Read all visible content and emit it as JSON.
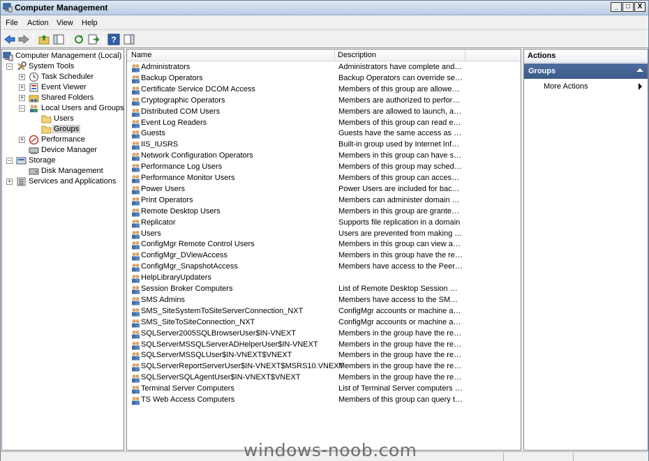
{
  "window": {
    "title": "Computer Management"
  },
  "window_buttons": [
    "_",
    "□",
    "X"
  ],
  "menu": [
    "File",
    "Action",
    "View",
    "Help"
  ],
  "tree": [
    {
      "label": "Computer Management (Local)",
      "level": 0,
      "expander": "",
      "icon": "computer-management-icon"
    },
    {
      "label": "System Tools",
      "level": 1,
      "expander": "−",
      "icon": "system-tools-icon"
    },
    {
      "label": "Task Scheduler",
      "level": 2,
      "expander": "+",
      "icon": "clock-icon"
    },
    {
      "label": "Event Viewer",
      "level": 2,
      "expander": "+",
      "icon": "event-viewer-icon"
    },
    {
      "label": "Shared Folders",
      "level": 2,
      "expander": "+",
      "icon": "shared-folder-icon"
    },
    {
      "label": "Local Users and Groups",
      "level": 2,
      "expander": "−",
      "icon": "users-icon"
    },
    {
      "label": "Users",
      "level": 3,
      "expander": "",
      "icon": "folder-icon"
    },
    {
      "label": "Groups",
      "level": 3,
      "expander": "",
      "icon": "folder-icon",
      "selected": true
    },
    {
      "label": "Performance",
      "level": 2,
      "expander": "+",
      "icon": "performance-icon"
    },
    {
      "label": "Device Manager",
      "level": 2,
      "expander": "",
      "icon": "device-manager-icon"
    },
    {
      "label": "Storage",
      "level": 1,
      "expander": "−",
      "icon": "storage-icon"
    },
    {
      "label": "Disk Management",
      "level": 2,
      "expander": "",
      "icon": "disk-icon"
    },
    {
      "label": "Services and Applications",
      "level": 1,
      "expander": "+",
      "icon": "services-icon"
    }
  ],
  "list": {
    "columns": [
      "Name",
      "Description"
    ],
    "rows": [
      {
        "name": "Administrators",
        "description": "Administrators have complete and u..."
      },
      {
        "name": "Backup Operators",
        "description": "Backup Operators can override secu..."
      },
      {
        "name": "Certificate Service DCOM Access",
        "description": "Members of this group are allowed t..."
      },
      {
        "name": "Cryptographic Operators",
        "description": "Members are authorized to perform ..."
      },
      {
        "name": "Distributed COM Users",
        "description": "Members are allowed to launch, acti..."
      },
      {
        "name": "Event Log Readers",
        "description": "Members of this group can read eve..."
      },
      {
        "name": "Guests",
        "description": "Guests have the same access as me..."
      },
      {
        "name": "IIS_IUSRS",
        "description": "Built-in group used by Internet Infor..."
      },
      {
        "name": "Network Configuration Operators",
        "description": "Members in this group can have som..."
      },
      {
        "name": "Performance Log Users",
        "description": "Members of this group may schedule..."
      },
      {
        "name": "Performance Monitor Users",
        "description": "Members of this group can access p..."
      },
      {
        "name": "Power Users",
        "description": "Power Users are included for backw..."
      },
      {
        "name": "Print Operators",
        "description": "Members can administer domain prin..."
      },
      {
        "name": "Remote Desktop Users",
        "description": "Members in this group are granted t..."
      },
      {
        "name": "Replicator",
        "description": "Supports file replication in a domain"
      },
      {
        "name": "Users",
        "description": "Users are prevented from making ac..."
      },
      {
        "name": "ConfigMgr Remote Control Users",
        "description": "Members in this group can view and ..."
      },
      {
        "name": "ConfigMgr_DViewAccess",
        "description": "Members in this group have the requ..."
      },
      {
        "name": "ConfigMgr_SnapshotAccess",
        "description": "Members have access to the Peer sit..."
      },
      {
        "name": "HelpLibraryUpdaters",
        "description": ""
      },
      {
        "name": "Session Broker Computers",
        "description": "List of Remote Desktop Session Host..."
      },
      {
        "name": "SMS Admins",
        "description": "Members have access to the SMS Pr..."
      },
      {
        "name": "SMS_SiteSystemToSiteServerConnection_NXT",
        "description": "ConfigMgr accounts or machine acco..."
      },
      {
        "name": "SMS_SiteToSiteConnection_NXT",
        "description": "ConfigMgr accounts or machine acco..."
      },
      {
        "name": "SQLServer2005SQLBrowserUser$IN-VNEXT",
        "description": "Members in the group have the requ..."
      },
      {
        "name": "SQLServerMSSQLServerADHelperUser$IN-VNEXT",
        "description": "Members in the group have the requ..."
      },
      {
        "name": "SQLServerMSSQLUser$IN-VNEXT$VNEXT",
        "description": "Members in the group have the requ..."
      },
      {
        "name": "SQLServerReportServerUser$IN-VNEXT$MSRS10.VNEXT",
        "description": "Members in the group have the requ..."
      },
      {
        "name": "SQLServerSQLAgentUser$IN-VNEXT$VNEXT",
        "description": "Members in the group have the requ..."
      },
      {
        "name": "Terminal Server Computers",
        "description": "List of Terminal Server computers all..."
      },
      {
        "name": "TS Web Access Computers",
        "description": "Members of this group can query th..."
      }
    ]
  },
  "actions": {
    "header": "Actions",
    "group": "Groups",
    "items": [
      "More Actions"
    ]
  },
  "watermark": "windows-noob.com"
}
